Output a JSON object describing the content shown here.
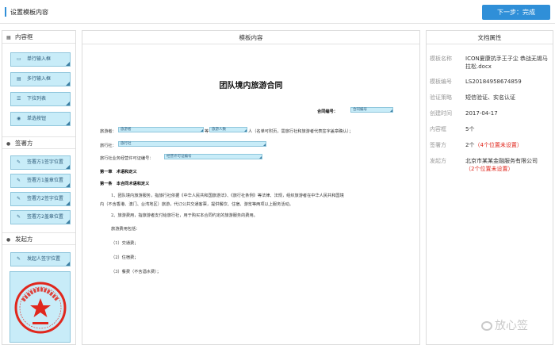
{
  "header": {
    "title": "设置模板内容",
    "next_label": "下一步：完成"
  },
  "left": {
    "sections": [
      {
        "title": "内容框",
        "icon": "grid-icon"
      },
      {
        "title": "签署方",
        "icon": "user-icon"
      },
      {
        "title": "发起方",
        "icon": "user-icon"
      }
    ],
    "content_tools": [
      "单行输入框",
      "多行输入框",
      "下拉列表",
      "单选按钮"
    ],
    "signer_tools": [
      "签署方1签字位置",
      "签署方1盖章位置",
      "签署方2签字位置",
      "签署方2盖章位置"
    ],
    "initiator_tools": [
      "发起人签字位置"
    ]
  },
  "middle": {
    "title": "模板内容",
    "doc": {
      "heading": "团队境内旅游合同",
      "contract_no_label": "合同编号：",
      "contract_no_field": "合同编号",
      "line1_a": "旅游者：",
      "line1_field1": "旅游者",
      "line1_mid": "等",
      "line1_field2": "旅游人数",
      "line1_b": "人（名单可附页，需旅行社和旅游者代表签字盖章确认）；",
      "line2_label": "旅行社：",
      "line2_field": "旅行社",
      "line3_label": "旅行社业务经营许可证编号：",
      "line3_field": "经营许可证编号",
      "ch1": "第一章　术语和定义",
      "ch1_1": "第一条　本合同术语和定义",
      "p1": "1、团队境内旅游服务，指旅行社依据《中华人民共和国旅游法》、《旅行社条例》等法律、法规，组织旅游者在中华人民共和国境",
      "p1b": "内（不含香港、澳门、台湾地区）旅游，代订公共交通客票，提供餐饮、住宿、游览等两项以上服务活动。",
      "p2": "2、旅游费用，指旅游者支付给旅行社，用于购买本合同约定的旅游服务的费用。",
      "p3": "旅游费用包括：",
      "p4": "（1）交通费；",
      "p5": "（2）住宿费；",
      "p6": "（3）餐费（不含酒水费）；"
    }
  },
  "right": {
    "title": "文档属性",
    "props": [
      {
        "k": "模板名称",
        "v": "ICON夏康抗手王子尘 恭战无锡马拉松.docx"
      },
      {
        "k": "模板编号",
        "v": "LS20184958674859"
      },
      {
        "k": "验证策略",
        "v": "短信验证、实名认证"
      },
      {
        "k": "创建时间",
        "v": "2017-04-17"
      },
      {
        "k": "内容框",
        "v": "5个"
      },
      {
        "k": "签署方",
        "v": "2个",
        "extra": "（4个位置未设置）"
      },
      {
        "k": "发起方",
        "v": "北京市某某金融服务有限公司",
        "extra": "（2个位置未设置）"
      }
    ]
  },
  "watermark": "放心签",
  "colors": {
    "accent": "#2f8fd8",
    "tool_bg": "#c8ecf8",
    "warn": "#e0271d",
    "seal_red": "#e0271d"
  }
}
